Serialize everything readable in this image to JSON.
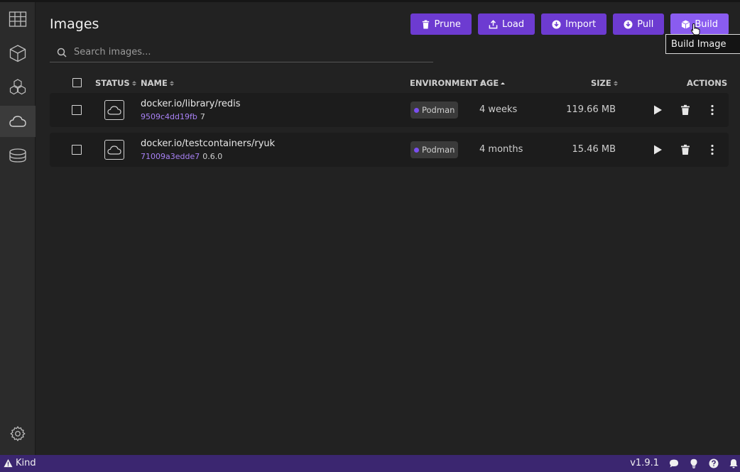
{
  "page": {
    "title": "Images",
    "search_placeholder": "Search images...",
    "tooltip": "Build Image"
  },
  "toolbar": {
    "buttons": [
      {
        "label": "Prune",
        "icon": "trash-icon"
      },
      {
        "label": "Load",
        "icon": "upload-icon"
      },
      {
        "label": "Import",
        "icon": "download-circle-icon"
      },
      {
        "label": "Pull",
        "icon": "download-circle-icon"
      },
      {
        "label": "Build",
        "icon": "cube-icon"
      }
    ]
  },
  "table": {
    "headers": {
      "status": "STATUS",
      "name": "NAME",
      "environment": "ENVIRONMENT",
      "age": "AGE",
      "size": "SIZE",
      "actions": "ACTIONS"
    },
    "rows": [
      {
        "name": "docker.io/library/redis",
        "id": "9509c4dd19fb",
        "tag": "7",
        "environment": "Podman",
        "age": "4 weeks",
        "size": "119.66 MB"
      },
      {
        "name": "docker.io/testcontainers/ryuk",
        "id": "71009a3edde7",
        "tag": "0.6.0",
        "environment": "Podman",
        "age": "4 months",
        "size": "15.46 MB"
      }
    ]
  },
  "sidebar": {
    "items": [
      {
        "icon": "dashboard-icon"
      },
      {
        "icon": "container-cube-icon"
      },
      {
        "icon": "pods-icon"
      },
      {
        "icon": "cloud-images-icon",
        "active": true
      },
      {
        "icon": "volume-icon"
      }
    ],
    "settings_icon": "gear-icon"
  },
  "statusbar": {
    "left_label": "Kind",
    "version": "v1.9.1"
  },
  "colors": {
    "accent": "#6d3bd1",
    "accent_hover": "#8a5cf0",
    "link": "#a881f5",
    "statusbar": "#3b2670"
  }
}
